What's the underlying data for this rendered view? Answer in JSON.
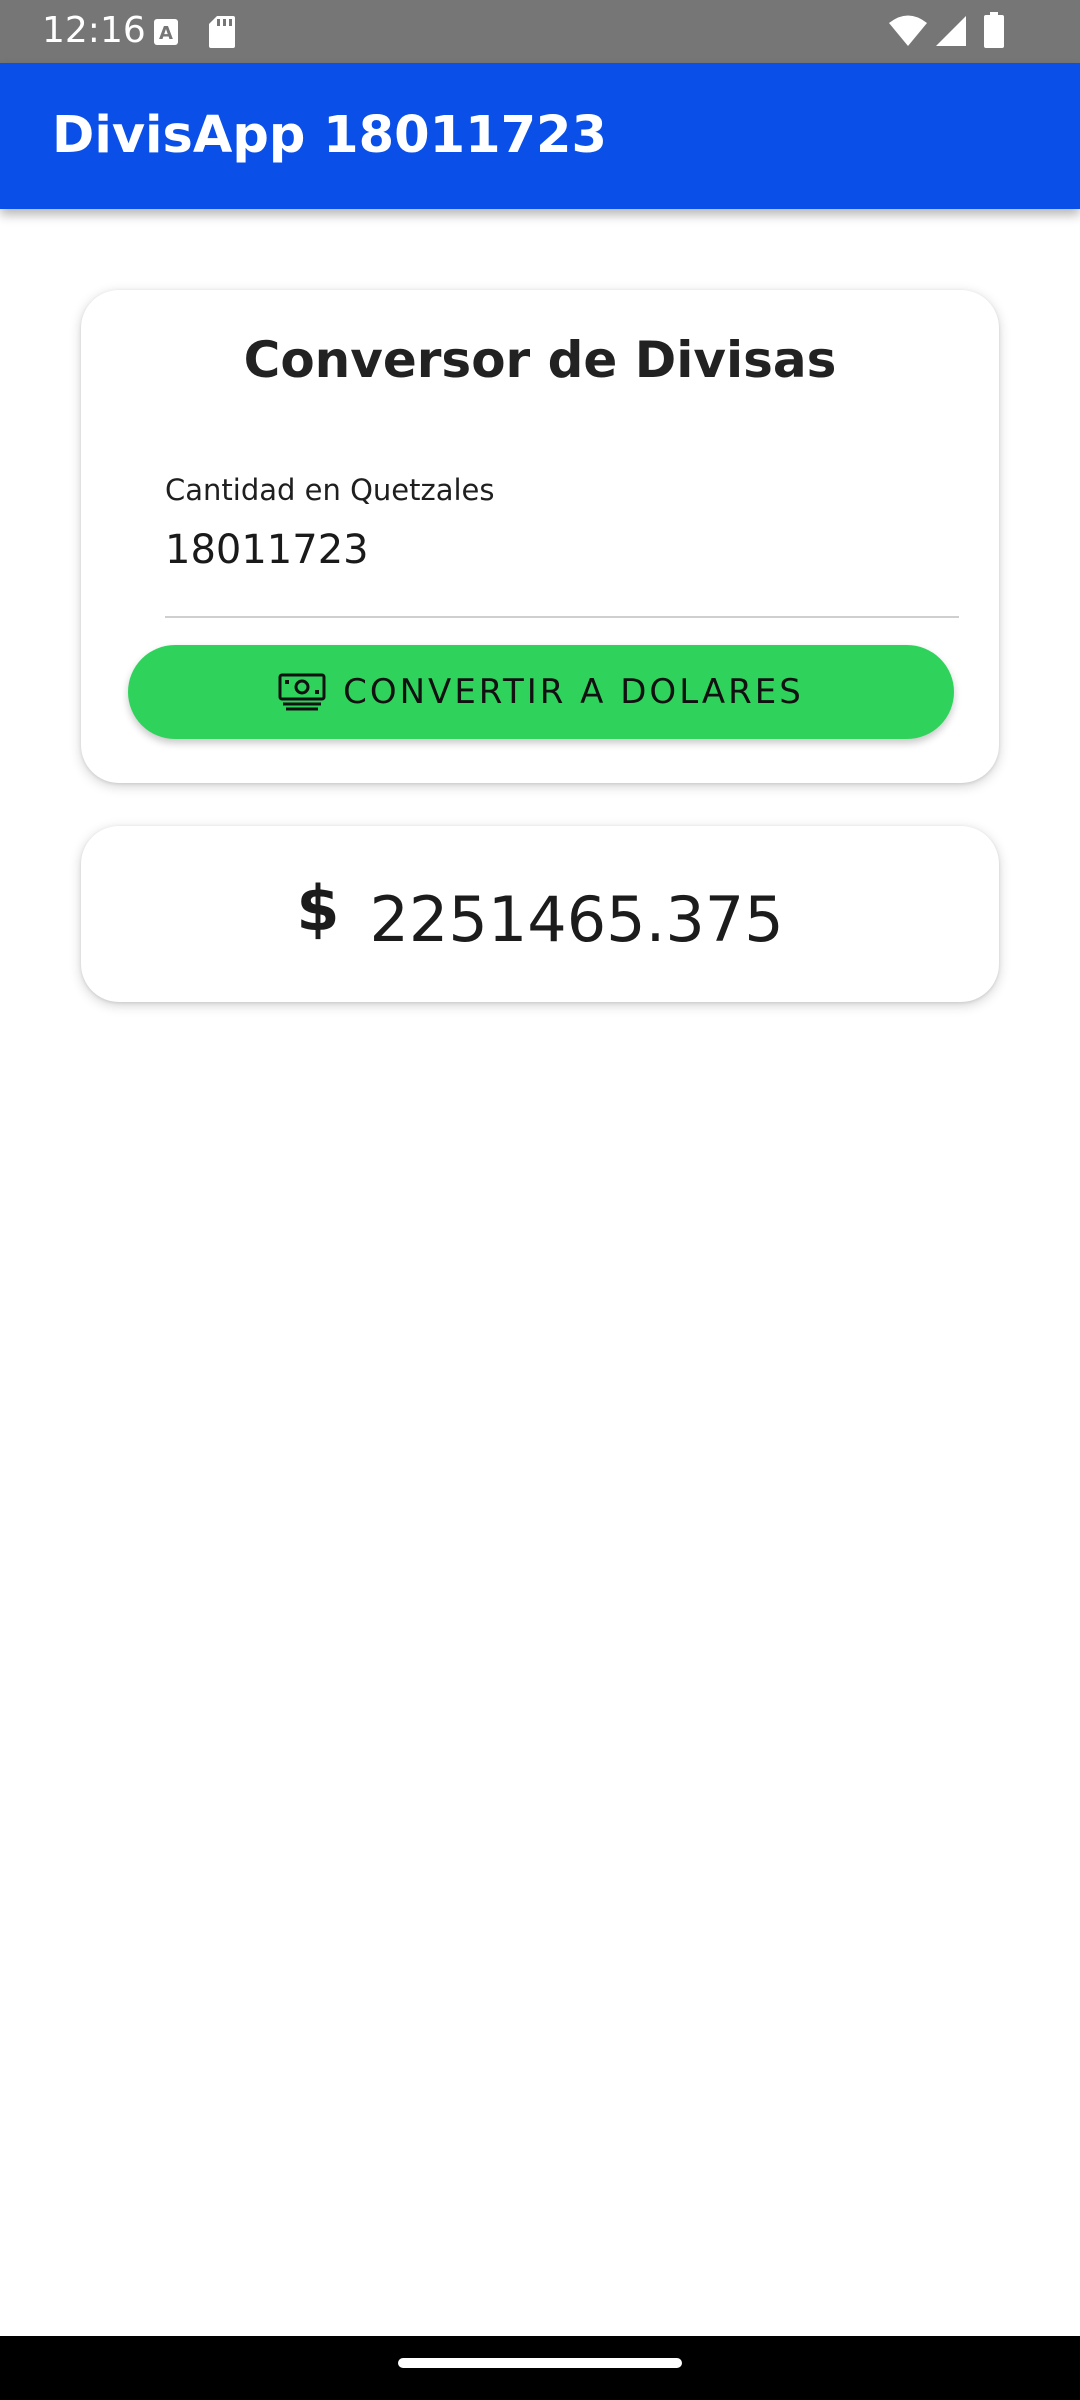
{
  "status_bar": {
    "time": "12:16",
    "left_icons": [
      "font-a-icon",
      "sd-card-icon"
    ],
    "right_icons": [
      "wifi-icon",
      "cell-signal-icon",
      "battery-icon"
    ],
    "background": "#767676"
  },
  "app_bar": {
    "title": "DivisApp 18011723",
    "background": "#0a50e8"
  },
  "converter": {
    "title": "Conversor de Divisas",
    "input_label": "Cantidad en Quetzales",
    "input_value": "18011723",
    "button_label": "CONVERTIR A DOLARES",
    "button_icon": "money-icon",
    "button_color": "#2fd35c"
  },
  "result": {
    "symbol": "$",
    "value": "2251465.375"
  }
}
